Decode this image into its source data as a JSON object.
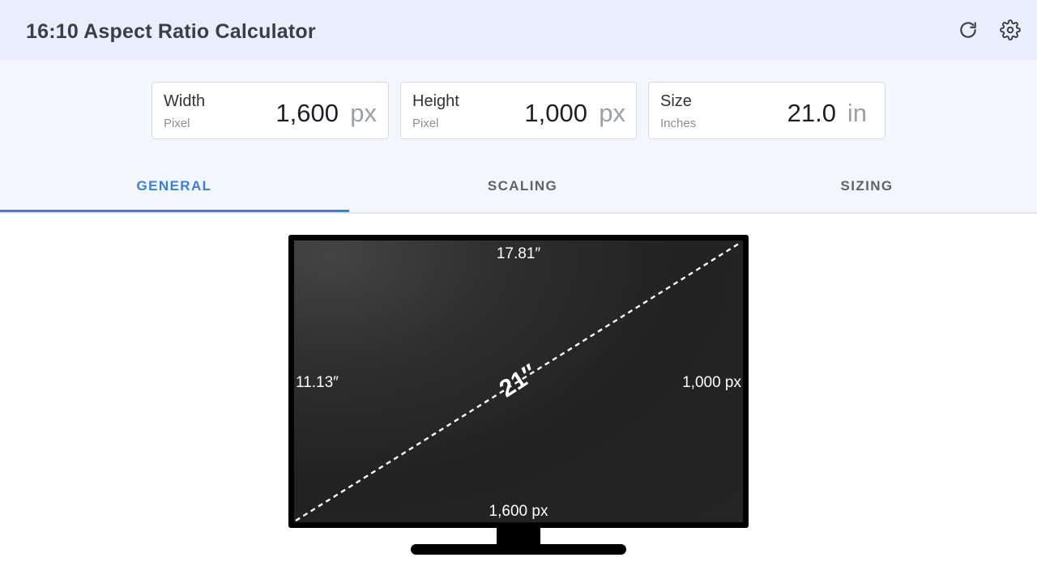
{
  "app": {
    "title": "16:10 Aspect Ratio Calculator",
    "icons": {
      "refresh": "refresh-icon",
      "settings": "gear-icon"
    }
  },
  "fields": {
    "width": {
      "label": "Width",
      "sublabel": "Pixel",
      "value": "1,600",
      "unit": "px"
    },
    "height": {
      "label": "Height",
      "sublabel": "Pixel",
      "value": "1,000",
      "unit": "px"
    },
    "size": {
      "label": "Size",
      "sublabel": "Inches",
      "value": "21.0",
      "unit": "in"
    }
  },
  "tabs": [
    {
      "label": "GENERAL",
      "active": true
    },
    {
      "label": "SCALING",
      "active": false
    },
    {
      "label": "SIZING",
      "active": false
    }
  ],
  "monitor": {
    "width_inches": "17.81″",
    "height_inches": "11.13″",
    "height_px": "1,000 px",
    "width_px": "1,600 px",
    "diagonal": "21″"
  },
  "colors": {
    "accent": "#3d7edc",
    "header_bg": "#e8eefb",
    "band_bg": "#f3f6fd",
    "monitor": "#000000"
  }
}
